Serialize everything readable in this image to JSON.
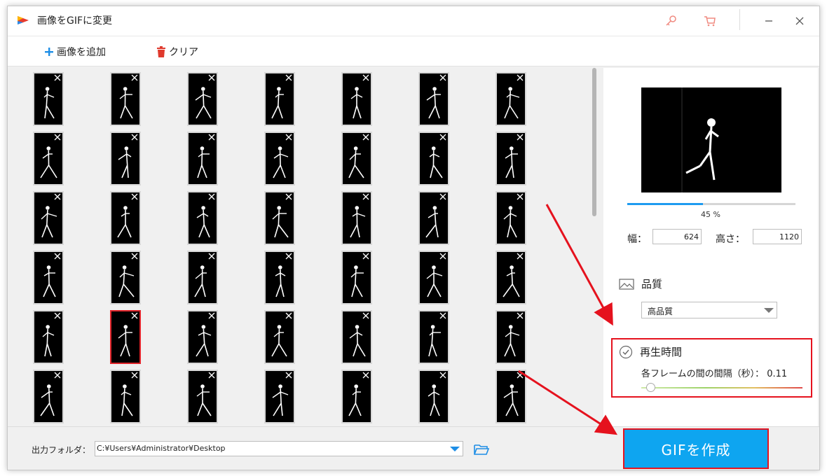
{
  "window": {
    "title": "画像をGIFに変更"
  },
  "toolbar": {
    "add_label": "画像を追加",
    "clear_label": "クリア"
  },
  "thumbnails": {
    "rows": 6,
    "cols": 7,
    "selected_index": 29
  },
  "preview": {
    "progress_percent": 45,
    "progress_text": "45 %"
  },
  "dimensions": {
    "width_label": "幅：",
    "width_value": "624",
    "height_label": "高さ：",
    "height_value": "1120"
  },
  "quality": {
    "label": "品質",
    "selected": "高品質"
  },
  "playback": {
    "label": "再生時間",
    "interval_text": "各フレームの間の間隔（秒）： 0.11",
    "interval_value": 0.11
  },
  "output": {
    "label": "出力フォルダ：",
    "path": "C:¥Users¥Administrator¥Desktop"
  },
  "create_button": {
    "label": "GIFを作成"
  },
  "colors": {
    "accent": "#0ea5f0",
    "highlight": "#e5121e",
    "progress": "#1e9bf0"
  },
  "icons": {
    "add": "plus-icon",
    "clear": "trash-icon",
    "key": "key-icon",
    "cart": "cart-icon",
    "minimize": "minimize-icon",
    "close": "close-icon",
    "quality": "image-icon",
    "playback": "clock-icon",
    "folder": "folder-icon"
  }
}
